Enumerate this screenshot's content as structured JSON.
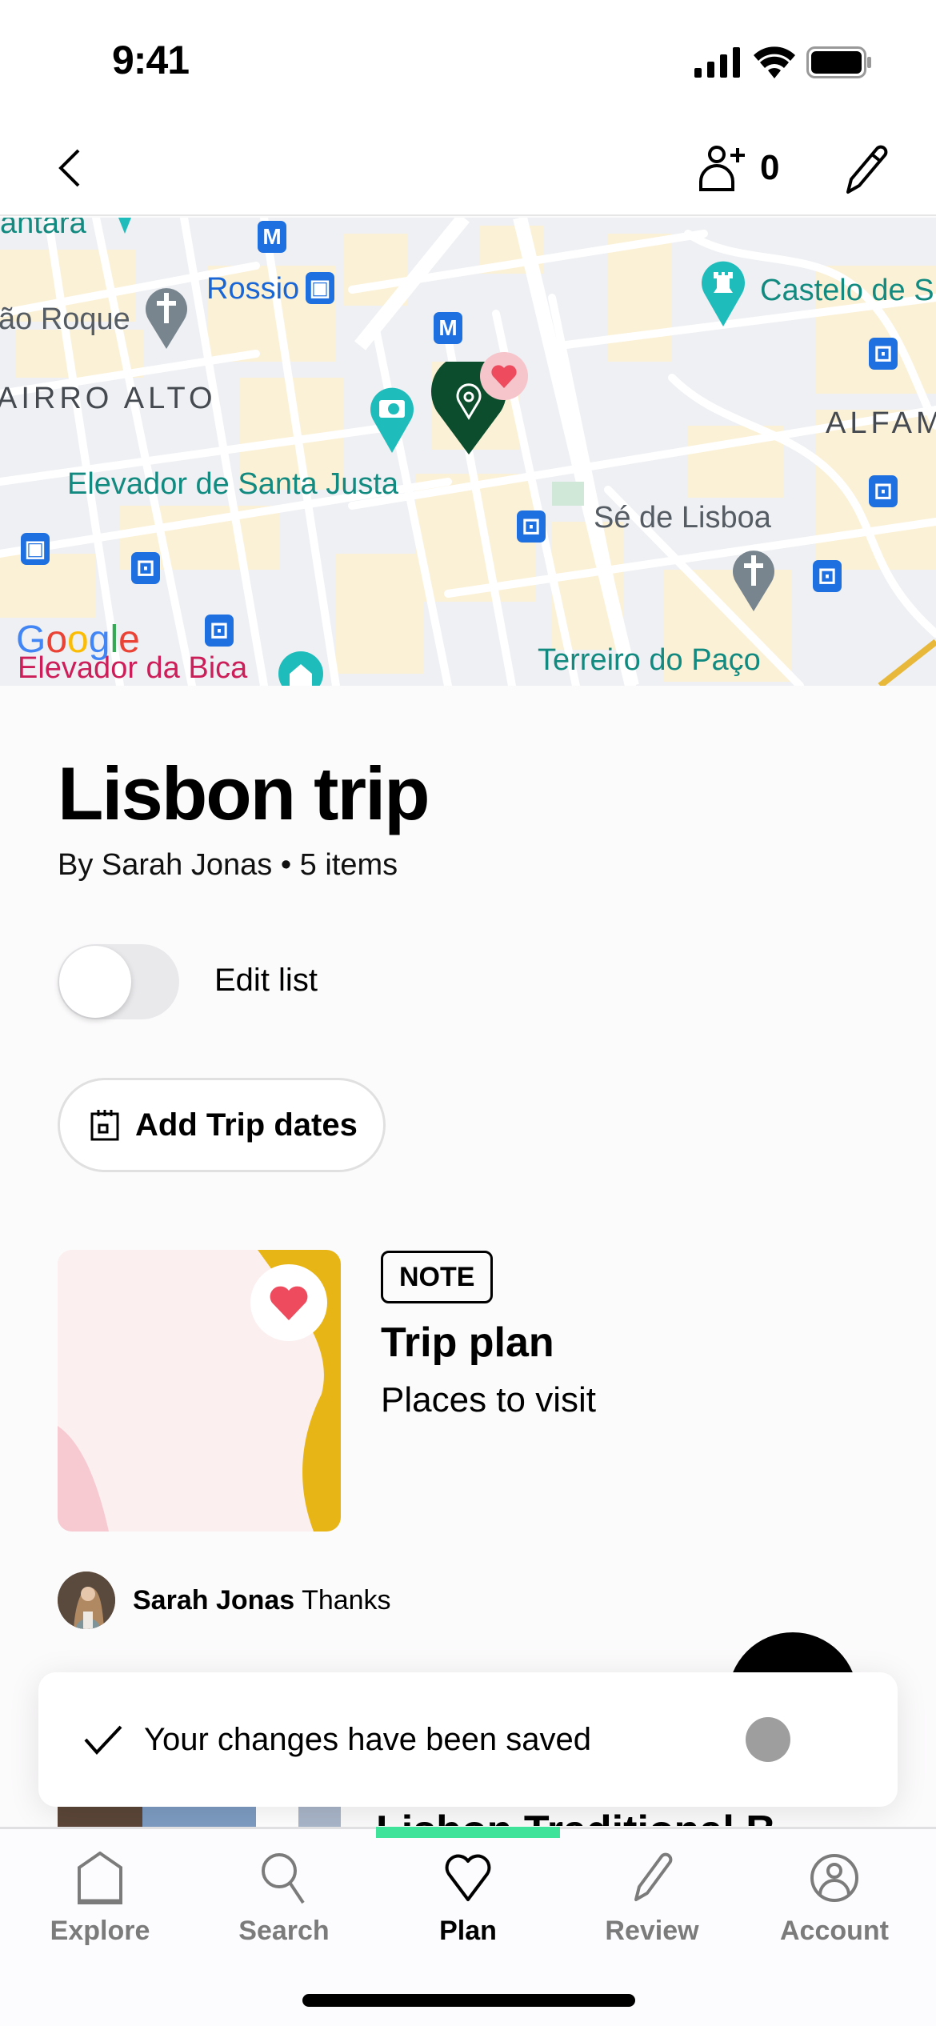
{
  "status_bar": {
    "time": "9:41",
    "icons": [
      "cellular-signal-icon",
      "wifi-icon",
      "battery-icon"
    ]
  },
  "nav_bar": {
    "back_icon": "chevron-left-icon",
    "collaborators_icon": "add-person-icon",
    "collaborators_count": "0",
    "edit_icon": "pencil-icon"
  },
  "map": {
    "labels": {
      "top_cut": "antara",
      "sao_roque": "ão Roque",
      "rossio": "Rossio",
      "bairro_alto": "AIRRO ALTO",
      "santa_justa": "Elevador de Santa Justa",
      "castelo": "Castelo de S",
      "alfama": "ALFAM",
      "se_lisboa": "Sé de Lisboa",
      "terreiro": "Terreiro do Paço",
      "bica": "Elevador da Bica"
    },
    "metro_glyph": "M",
    "attribution": [
      "G",
      "o",
      "o",
      "g",
      "l",
      "e"
    ],
    "colors": {
      "teal_poi": "#1fbcbc",
      "saved_pin": "#0b4d2c",
      "transit": "#1e6fe0",
      "church_pin": "#78858f",
      "block_yellow": "#fbf1d6"
    }
  },
  "trip": {
    "title": "Lisbon trip",
    "subtitle": "By Sarah Jonas • 5 items",
    "edit_toggle_label": "Edit list",
    "edit_toggle_on": false,
    "add_dates_label": "Add Trip dates"
  },
  "items": [
    {
      "badge": "NOTE",
      "title": "Trip plan",
      "description": "Places to visit",
      "saved": true,
      "comment": {
        "author": "Sarah Jonas",
        "text": "Thanks"
      }
    },
    {
      "title": "Lisbon Traditional B",
      "saved": true
    }
  ],
  "toast": {
    "icon": "checkmark-icon",
    "message": "Your changes have been saved"
  },
  "tab_bar": {
    "active": "Plan",
    "tabs": [
      {
        "label": "Explore",
        "icon": "home-icon"
      },
      {
        "label": "Search",
        "icon": "search-icon"
      },
      {
        "label": "Plan",
        "icon": "heart-icon"
      },
      {
        "label": "Review",
        "icon": "pencil-icon"
      },
      {
        "label": "Account",
        "icon": "account-icon"
      }
    ],
    "accent_color": "#3fe39a"
  }
}
